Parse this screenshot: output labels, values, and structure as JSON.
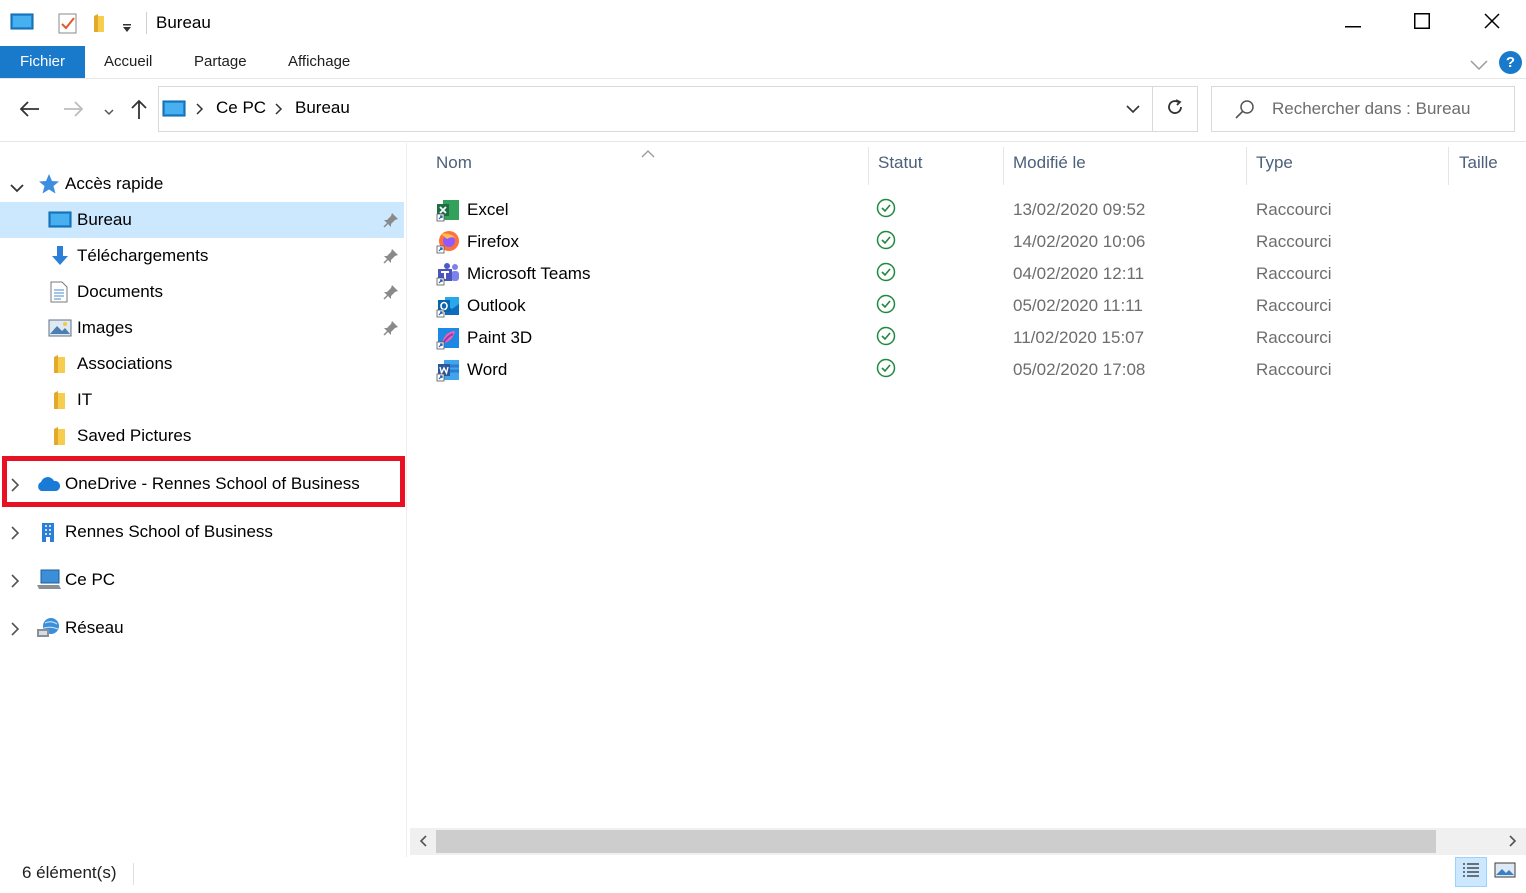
{
  "window": {
    "title": "Bureau",
    "quick_access_icons": [
      "desktop-icon",
      "properties-icon",
      "new-folder-icon",
      "customize-dropdown-icon"
    ],
    "controls": [
      "minimize-icon",
      "maximize-icon",
      "close-icon"
    ]
  },
  "ribbon": {
    "tabs": [
      {
        "label": "Fichier",
        "active": true
      },
      {
        "label": "Accueil"
      },
      {
        "label": "Partage"
      },
      {
        "label": "Affichage"
      }
    ],
    "help": "?"
  },
  "address": {
    "crumbs": [
      "Ce PC",
      "Bureau"
    ],
    "search_placeholder": "Rechercher dans : Bureau"
  },
  "nav": {
    "quick_access": {
      "label": "Accès rapide",
      "items": [
        {
          "label": "Bureau",
          "icon": "desktop-icon",
          "pinned": true,
          "selected": true
        },
        {
          "label": "Téléchargements",
          "icon": "download-icon",
          "pinned": true
        },
        {
          "label": "Documents",
          "icon": "documents-icon",
          "pinned": true
        },
        {
          "label": "Images",
          "icon": "pictures-icon",
          "pinned": true
        },
        {
          "label": "Associations",
          "icon": "folder-icon"
        },
        {
          "label": "IT",
          "icon": "folder-icon"
        },
        {
          "label": "Saved Pictures",
          "icon": "folder-icon"
        }
      ]
    },
    "roots": [
      {
        "label": "OneDrive - Rennes School of Business",
        "icon": "onedrive-cloud-icon",
        "highlighted": true
      },
      {
        "label": "Rennes School of Business",
        "icon": "building-icon"
      },
      {
        "label": "Ce PC",
        "icon": "this-pc-icon"
      },
      {
        "label": "Réseau",
        "icon": "network-icon"
      }
    ]
  },
  "files": {
    "columns": [
      "Nom",
      "Statut",
      "Modifié le",
      "Type",
      "Taille"
    ],
    "rows": [
      {
        "name": "Excel",
        "date": "13/02/2020 09:52",
        "type": "Raccourci",
        "icon": "excel-icon",
        "color": "#1d6f42"
      },
      {
        "name": "Firefox",
        "date": "14/02/2020 10:06",
        "type": "Raccourci",
        "icon": "firefox-icon",
        "color": "#ff7139"
      },
      {
        "name": "Microsoft Teams",
        "date": "04/02/2020 12:11",
        "type": "Raccourci",
        "icon": "teams-icon",
        "color": "#5059c9"
      },
      {
        "name": "Outlook",
        "date": "05/02/2020 11:11",
        "type": "Raccourci",
        "icon": "outlook-icon",
        "color": "#0f6cbd"
      },
      {
        "name": "Paint 3D",
        "date": "11/02/2020 15:07",
        "type": "Raccourci",
        "icon": "paint3d-icon",
        "color": "#7a3fd1"
      },
      {
        "name": "Word",
        "date": "05/02/2020 17:08",
        "type": "Raccourci",
        "icon": "word-icon",
        "color": "#2b579a"
      }
    ],
    "status_icon": "sync-ok-check-icon",
    "status_color": "#1e8a3e"
  },
  "status": {
    "count": "6 élément(s)"
  },
  "colors": {
    "accent": "#1979ca",
    "selection": "#cce8ff",
    "highlight": "#e81123"
  }
}
